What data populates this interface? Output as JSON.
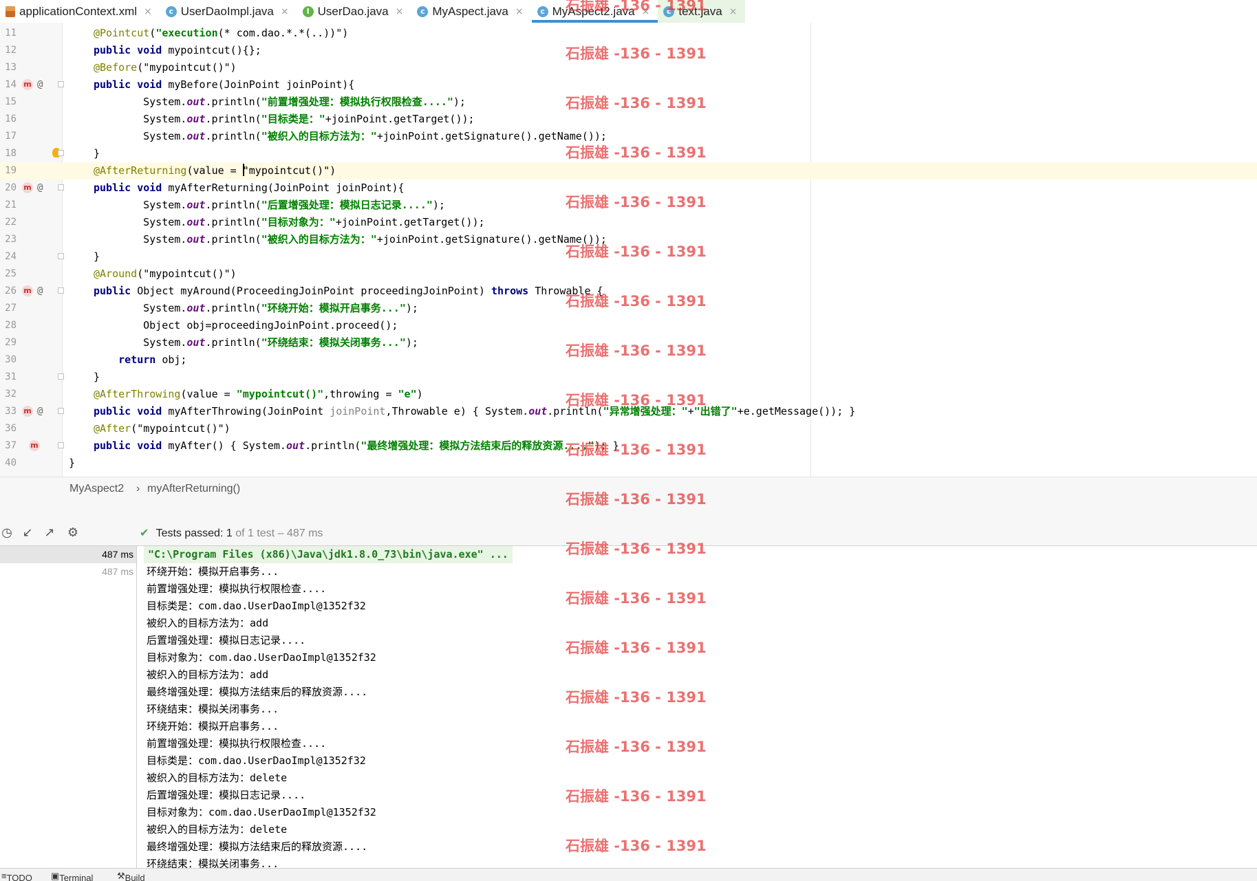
{
  "tabs": [
    {
      "label": "applicationContext.xml",
      "icon": "xml-file-icon"
    },
    {
      "label": "UserDaoImpl.java",
      "icon": "class-icon"
    },
    {
      "label": "UserDao.java",
      "icon": "interface-icon"
    },
    {
      "label": "MyAspect.java",
      "icon": "class-icon"
    },
    {
      "label": "MyAspect2.java",
      "icon": "class-icon",
      "active": true
    },
    {
      "label": "text.java",
      "icon": "class-icon"
    }
  ],
  "editor": {
    "line_numbers": [
      "11",
      "12",
      "13",
      "14",
      "15",
      "16",
      "17",
      "18",
      "19",
      "20",
      "21",
      "22",
      "23",
      "24",
      "25",
      "26",
      "27",
      "28",
      "29",
      "30",
      "31",
      "32",
      "33",
      "36",
      "37",
      "40"
    ],
    "lines": [
      {
        "t": [
          [
            "ann",
            "@Pointcut"
          ],
          [
            "",
            "("
          ],
          [
            "str",
            "\"execution"
          ],
          [
            "",
            "(* com.dao.*.*(..))\""
          ],
          [
            "",
            ")"
          ]
        ]
      },
      {
        "t": [
          [
            "kw",
            "public void "
          ],
          [
            "",
            "mypointcut(){};"
          ]
        ]
      },
      {
        "t": [
          [
            "ann",
            "@Before"
          ],
          [
            "",
            "(\"mypointcut()\")"
          ]
        ]
      },
      {
        "t": [
          [
            "kw",
            "public void "
          ],
          [
            "",
            "myBefore(JoinPoint joinPoint){"
          ]
        ]
      },
      {
        "t": [
          [
            "",
            "    System."
          ],
          [
            "fld",
            "out"
          ],
          [
            "",
            ".println("
          ],
          [
            "str",
            "\"前置增强处理：模拟执行权限检查....\""
          ],
          [
            "",
            ");"
          ]
        ]
      },
      {
        "t": [
          [
            "",
            "    System."
          ],
          [
            "fld",
            "out"
          ],
          [
            "",
            ".println("
          ],
          [
            "str",
            "\"目标类是："
          ],
          [
            "str",
            "\""
          ],
          [
            "",
            "+joinPoint.getTarget());"
          ]
        ]
      },
      {
        "t": [
          [
            "",
            "    System."
          ],
          [
            "fld",
            "out"
          ],
          [
            "",
            ".println("
          ],
          [
            "str",
            "\"被织入的目标方法为：\""
          ],
          [
            "",
            "+joinPoint.getSignature().getName());"
          ]
        ]
      },
      {
        "t": [
          [
            "",
            "}"
          ]
        ]
      },
      {
        "t": [
          [
            "ann",
            "@AfterReturning"
          ],
          [
            "",
            "(value = "
          ],
          [
            "caret",
            ""
          ],
          [
            "",
            "\"mypointcut()\")"
          ]
        ]
      },
      {
        "t": [
          [
            "kw",
            "public void "
          ],
          [
            "",
            "myAfterReturning(JoinPoint joinPoint){"
          ]
        ]
      },
      {
        "t": [
          [
            "",
            "    System."
          ],
          [
            "fld",
            "out"
          ],
          [
            "",
            ".println("
          ],
          [
            "str",
            "\"后置增强处理：模拟日志记录....\""
          ],
          [
            "",
            ");"
          ]
        ]
      },
      {
        "t": [
          [
            "",
            "    System."
          ],
          [
            "fld",
            "out"
          ],
          [
            "",
            ".println("
          ],
          [
            "str",
            "\"目标对象为：\""
          ],
          [
            "",
            "+joinPoint.getTarget());"
          ]
        ]
      },
      {
        "t": [
          [
            "",
            "    System."
          ],
          [
            "fld",
            "out"
          ],
          [
            "",
            ".println("
          ],
          [
            "str",
            "\"被织入的目标方法为：\""
          ],
          [
            "",
            "+joinPoint.getSignature().getName());"
          ]
        ]
      },
      {
        "t": [
          [
            "",
            "}"
          ]
        ]
      },
      {
        "t": [
          [
            "ann",
            "@Around"
          ],
          [
            "",
            "(\"mypointcut()\")"
          ]
        ]
      },
      {
        "t": [
          [
            "kw",
            "public "
          ],
          [
            "",
            "Object myAround(ProceedingJoinPoint proceedingJoinPoint) "
          ],
          [
            "kw",
            "throws "
          ],
          [
            "",
            "Throwable {"
          ]
        ]
      },
      {
        "t": [
          [
            "",
            "    System."
          ],
          [
            "fld",
            "out"
          ],
          [
            "",
            ".println("
          ],
          [
            "str",
            "\"环绕开始：模拟开启事务...\""
          ],
          [
            "",
            ");"
          ]
        ]
      },
      {
        "t": [
          [
            "",
            "    Object obj=proceedingJoinPoint.proceed();"
          ]
        ]
      },
      {
        "t": [
          [
            "",
            "    System."
          ],
          [
            "fld",
            "out"
          ],
          [
            "",
            ".println("
          ],
          [
            "str",
            "\"环绕结束：模拟关闭事务...\""
          ],
          [
            "",
            ");"
          ]
        ]
      },
      {
        "t": [
          [
            "kw",
            "    return "
          ],
          [
            "",
            "obj;"
          ]
        ]
      },
      {
        "t": [
          [
            "",
            "}"
          ]
        ]
      },
      {
        "t": [
          [
            "ann",
            "@AfterThrowing"
          ],
          [
            "",
            "(value = "
          ],
          [
            "str",
            "\"mypointcut()\""
          ],
          [
            "",
            ",throwing = "
          ],
          [
            "str",
            "\"e\""
          ],
          [
            "",
            ")"
          ]
        ]
      },
      {
        "t": [
          [
            "kw",
            "public void "
          ],
          [
            "",
            "myAfterThrowing(JoinPoint "
          ],
          [
            "pgray",
            "joinPoint"
          ],
          [
            "",
            ",Throwable e) { System."
          ],
          [
            "fld",
            "out"
          ],
          [
            "",
            ".println("
          ],
          [
            "str",
            "\"异常增强处理：\""
          ],
          [
            "",
            "+"
          ],
          [
            "str",
            "\"出错了\""
          ],
          [
            "",
            "+e.getMessage()); }"
          ]
        ]
      },
      {
        "t": [
          [
            "ann",
            "@After"
          ],
          [
            "",
            "(\"mypointcut()\")"
          ]
        ]
      },
      {
        "t": [
          [
            "kw",
            "public void "
          ],
          [
            "",
            "myAfter() { System."
          ],
          [
            "fld",
            "out"
          ],
          [
            "",
            ".println("
          ],
          [
            "str",
            "\"最终增强处理：模拟方法结束后的释放资源....\""
          ],
          [
            "",
            "); }"
          ]
        ]
      },
      {
        "t": [
          [
            "",
            "}"
          ]
        ]
      }
    ]
  },
  "breadcrumb": {
    "file": "MyAspect2",
    "sep": "›",
    "method": "myAfterReturning()"
  },
  "run": {
    "tests_passed": "Tests passed:",
    "count": "1",
    "of_total": "of 1 test",
    "duration": "– 487 ms",
    "tree_times": [
      "487 ms",
      "487 ms"
    ],
    "command": "\"C:\\Program Files (x86)\\Java\\jdk1.8.0_73\\bin\\java.exe\" ...",
    "console": [
      "环绕开始：模拟开启事务...",
      "前置增强处理：模拟执行权限检查....",
      "目标类是：com.dao.UserDaoImpl@1352f32",
      "被织入的目标方法为：add",
      "后置增强处理：模拟日志记录....",
      "目标对象为：com.dao.UserDaoImpl@1352f32",
      "被织入的目标方法为：add",
      "最终增强处理：模拟方法结束后的释放资源....",
      "环绕结束：模拟关闭事务...",
      "环绕开始：模拟开启事务...",
      "前置增强处理：模拟执行权限检查....",
      "目标类是：com.dao.UserDaoImpl@1352f32",
      "被织入的目标方法为：delete",
      "后置增强处理：模拟日志记录....",
      "目标对象为：com.dao.UserDaoImpl@1352f32",
      "被织入的目标方法为：delete",
      "最终增强处理：模拟方法结束后的释放资源....",
      "环绕结束：模拟关闭事务..."
    ]
  },
  "bottom_tools": [
    "TODO",
    "Terminal",
    "Build"
  ],
  "watermark": "石振雄 -136 - 1391",
  "colors": {
    "annotation": "#808000",
    "keyword": "#000080",
    "string": "#008000",
    "field": "#660e7a",
    "active_tab": "#3f8fd2",
    "watermark": "#e23b3b"
  }
}
